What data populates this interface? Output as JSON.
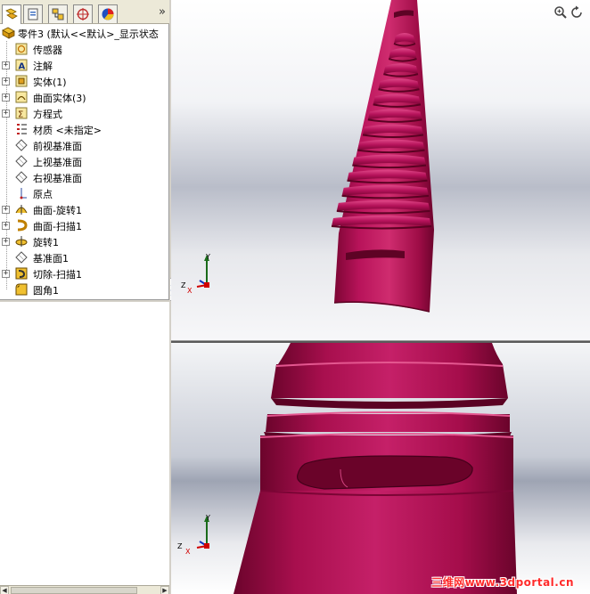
{
  "panel": {
    "tabs": [
      {
        "name": "featuremanager-tab",
        "icon": "featuremanager-tree-icon",
        "active": true
      },
      {
        "name": "propertymanager-tab",
        "icon": "propertymanager-icon",
        "active": false
      },
      {
        "name": "configurationmanager-tab",
        "icon": "configuration-icon",
        "active": false
      },
      {
        "name": "dimxpert-tab",
        "icon": "crosshair-target-icon",
        "active": false
      },
      {
        "name": "display-tab",
        "icon": "appearance-pie-icon",
        "active": false
      }
    ],
    "more_tabs": "»"
  },
  "tree": {
    "root": "零件3  (默认<<默认>_显示状态",
    "items": [
      {
        "label": "传感器",
        "icon": "sensor-icon",
        "expandable": false
      },
      {
        "label": "注解",
        "icon": "annotation-icon",
        "expandable": true
      },
      {
        "label": "实体(1)",
        "icon": "solid-body-icon",
        "expandable": true
      },
      {
        "label": "曲面实体(3)",
        "icon": "surface-body-icon",
        "expandable": true
      },
      {
        "label": "方程式",
        "icon": "equation-icon",
        "expandable": true
      },
      {
        "label": "材质 <未指定>",
        "icon": "material-icon",
        "expandable": false
      },
      {
        "label": "前视基准面",
        "icon": "plane-icon",
        "expandable": false
      },
      {
        "label": "上视基准面",
        "icon": "plane-icon",
        "expandable": false
      },
      {
        "label": "右视基准面",
        "icon": "plane-icon",
        "expandable": false
      },
      {
        "label": "原点",
        "icon": "origin-icon",
        "expandable": false
      },
      {
        "label": "曲面-旋转1",
        "icon": "surface-revolve-icon",
        "expandable": true
      },
      {
        "label": "曲面-扫描1",
        "icon": "surface-sweep-icon",
        "expandable": true
      },
      {
        "label": "旋转1",
        "icon": "revolve-icon",
        "expandable": true
      },
      {
        "label": "基准面1",
        "icon": "plane-icon",
        "expandable": false
      },
      {
        "label": "切除-扫描1",
        "icon": "cut-sweep-icon",
        "expandable": true
      },
      {
        "label": "圆角1",
        "icon": "fillet-icon",
        "expandable": false
      }
    ]
  },
  "viewports": {
    "top": {
      "triad": {
        "x": "X",
        "y": "Y",
        "z": "Z"
      }
    },
    "bottom": {
      "triad": {
        "x": "X",
        "y": "Y",
        "z": "Z"
      }
    }
  },
  "view_tools": {
    "zoom": "zoom-to-fit-icon",
    "rotate": "rotate-view-icon"
  },
  "watermark": "三维网www.3dportal.cn",
  "colors": {
    "part": "#a8104a",
    "part_highlight": "#d23a78",
    "background": "#b9bdc9",
    "axis_x": "#d00000",
    "axis_y": "#1a6b1a",
    "axis_z": "#1030c0"
  }
}
